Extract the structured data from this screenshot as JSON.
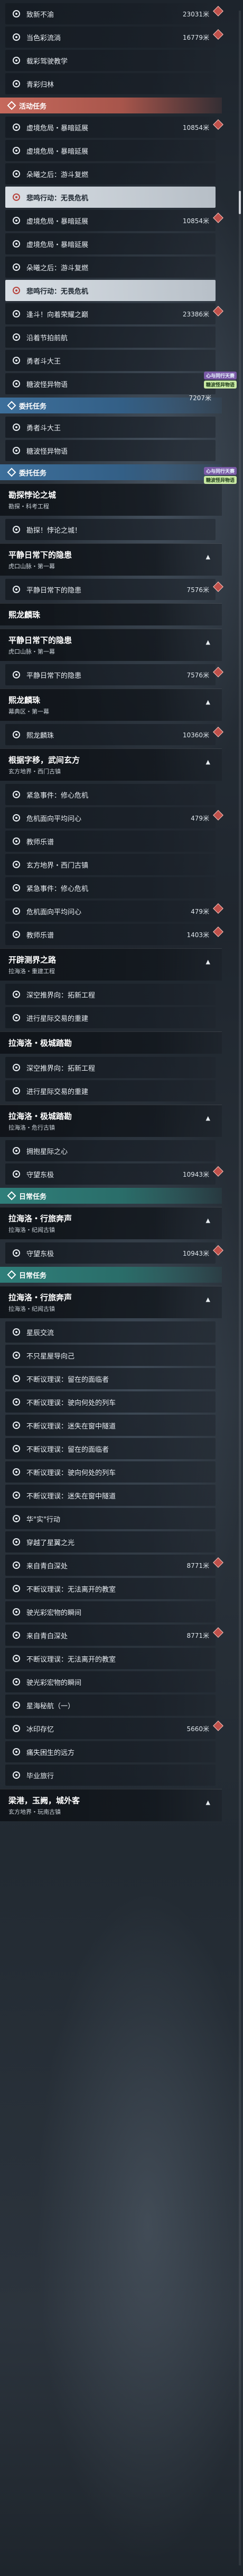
{
  "quest_list": {
    "items": [
      {
        "kind": "row",
        "name": "致新不渝",
        "dist": "23031米"
      },
      {
        "kind": "row",
        "name": "当色彩流淌",
        "dist": "16779米"
      },
      {
        "kind": "row",
        "name": "载彩驾驶教学",
        "dist": ""
      },
      {
        "kind": "row",
        "name": "青彩归林",
        "dist": ""
      },
      {
        "kind": "cat",
        "style": "event",
        "label": "活动任务"
      },
      {
        "kind": "row",
        "name": "虚境危局・暴暗延展",
        "dist": "10854米"
      },
      {
        "kind": "row",
        "name": "虚境危局・暴暗延展",
        "dist": ""
      },
      {
        "kind": "row",
        "name": "朵曦之后：游斗复燃",
        "dist": ""
      },
      {
        "kind": "row",
        "name": "悲鸣行动：无畏危机",
        "dist": "",
        "active": true
      },
      {
        "kind": "row",
        "name": "虚境危局・暴暗延展",
        "dist": "10854米"
      },
      {
        "kind": "row",
        "name": "虚境危局・暴暗延展",
        "dist": ""
      },
      {
        "kind": "row",
        "name": "朵曦之后：游斗复燃",
        "dist": ""
      },
      {
        "kind": "row",
        "name": "悲鸣行动：无畏危机",
        "dist": "",
        "active": true
      },
      {
        "kind": "row",
        "name": "逢斗！向着荣耀之巅",
        "dist": "23386米"
      },
      {
        "kind": "row",
        "name": "沿着节拍前航",
        "dist": ""
      },
      {
        "kind": "row",
        "name": "勇者斗大王",
        "dist": ""
      },
      {
        "kind": "row",
        "name": "糖波怪异物语",
        "dist": ""
      },
      {
        "kind": "cat",
        "style": "legend",
        "label": "委托任务"
      },
      {
        "kind": "row",
        "name": "勇者斗大王",
        "dist": ""
      },
      {
        "kind": "row",
        "name": "糖波怪异物语",
        "dist": ""
      },
      {
        "kind": "cat",
        "style": "legend",
        "label": "委托任务"
      },
      {
        "kind": "head",
        "title": "勘探悖论之城",
        "sub": "勘探・科考工程",
        "chev": ""
      },
      {
        "kind": "row",
        "name": "勘探！悖论之城！",
        "dist": ""
      },
      {
        "kind": "head",
        "title": "平静日常下的隐患",
        "sub": "虎口山脉・第一幕",
        "chev": "▲"
      },
      {
        "kind": "row",
        "name": "平静日常下的隐患",
        "dist": "7576米"
      },
      {
        "kind": "head",
        "title": "熙龙麟珠",
        "sub": "",
        "chev": ""
      },
      {
        "kind": "head",
        "title": "平静日常下的隐患",
        "sub": "虎口山脉・第一幕",
        "chev": "▲"
      },
      {
        "kind": "row",
        "name": "平静日常下的隐患",
        "dist": "7576米"
      },
      {
        "kind": "head",
        "title": "熙龙麟珠",
        "sub": "幕典区・第一幕",
        "chev": "▲"
      },
      {
        "kind": "row",
        "name": "熙龙麟珠",
        "dist": "10360米"
      },
      {
        "kind": "head",
        "title": "根据字移，武间玄方",
        "sub": "玄方地界・西门古镇",
        "chev": "▲"
      },
      {
        "kind": "row",
        "name": "紧急事件：修心危机",
        "dist": ""
      },
      {
        "kind": "row",
        "name": "危机面向平均问心",
        "dist": "479米"
      },
      {
        "kind": "row",
        "name": "教师乐谱",
        "dist": ""
      },
      {
        "kind": "row",
        "name": "玄方地界・西门古镇",
        "dist": ""
      },
      {
        "kind": "row",
        "name": "紧急事件：修心危机",
        "dist": ""
      },
      {
        "kind": "row",
        "name": "危机面向平均问心",
        "dist": "479米"
      },
      {
        "kind": "row",
        "name": "教师乐谱",
        "dist": "1403米"
      },
      {
        "kind": "head",
        "title": "开辟测界之路",
        "sub": "拉海洛・重建工程",
        "chev": "▲"
      },
      {
        "kind": "row",
        "name": "深空推界向：拓新工程",
        "dist": ""
      },
      {
        "kind": "row",
        "name": "进行星际交易的重建",
        "dist": ""
      },
      {
        "kind": "head",
        "title": "拉海洛・极城踏勘",
        "sub": "",
        "chev": ""
      },
      {
        "kind": "row",
        "name": "深空推界向：拓新工程",
        "dist": ""
      },
      {
        "kind": "row",
        "name": "进行星际交易的重建",
        "dist": ""
      },
      {
        "kind": "head",
        "title": "拉海洛・极城踏勘",
        "sub": "拉海洛・危行古镇",
        "chev": "▲"
      },
      {
        "kind": "row",
        "name": "拥抱星际之心",
        "dist": ""
      },
      {
        "kind": "row",
        "name": "守望东极",
        "dist": "10943米"
      },
      {
        "kind": "cat",
        "style": "daily",
        "label": "日常任务"
      },
      {
        "kind": "head",
        "title": "拉海洛・行旅奔声",
        "sub": "拉海洛・纪闻古镇",
        "chev": "▲"
      },
      {
        "kind": "row",
        "name": "守望东极",
        "dist": "10943米"
      },
      {
        "kind": "cat",
        "style": "daily",
        "label": "日常任务"
      },
      {
        "kind": "head",
        "title": "拉海洛・行旅奔声",
        "sub": "拉海洛・纪闻古镇",
        "chev": "▲"
      },
      {
        "kind": "row",
        "name": "星辰交流",
        "dist": ""
      },
      {
        "kind": "row",
        "name": "不只星屋导向己",
        "dist": ""
      },
      {
        "kind": "row",
        "name": "不断议理误：留在的面临者",
        "dist": ""
      },
      {
        "kind": "row",
        "name": "不断议理误：驶向何处的列车",
        "dist": ""
      },
      {
        "kind": "row",
        "name": "不断议理误：迷失在窗中隧道",
        "dist": ""
      },
      {
        "kind": "row",
        "name": "不断议理误：留在的面临者",
        "dist": ""
      },
      {
        "kind": "row",
        "name": "不断议理误：驶向何处的列车",
        "dist": ""
      },
      {
        "kind": "row",
        "name": "不断议理误：迷失在窗中隧道",
        "dist": ""
      },
      {
        "kind": "row",
        "name": "华\"实\"行动",
        "dist": ""
      },
      {
        "kind": "row",
        "name": "穿越了星翼之光",
        "dist": ""
      },
      {
        "kind": "row",
        "name": "来自青白深处",
        "dist": "8771米"
      },
      {
        "kind": "row",
        "name": "不断议理误：无法离开的教室",
        "dist": ""
      },
      {
        "kind": "row",
        "name": "驶光彩宏物的瞬间",
        "dist": ""
      },
      {
        "kind": "row",
        "name": "来自青白深处",
        "dist": "8771米"
      },
      {
        "kind": "row",
        "name": "不断议理误：无法离开的教室",
        "dist": ""
      },
      {
        "kind": "row",
        "name": "驶光彩宏物的瞬间",
        "dist": ""
      },
      {
        "kind": "row",
        "name": "星海秘航（一）",
        "dist": ""
      },
      {
        "kind": "row",
        "name": "冰印存忆",
        "dist": "5660米"
      },
      {
        "kind": "row",
        "name": "痛失困生的远方",
        "dist": ""
      },
      {
        "kind": "row",
        "name": "毕业旅行",
        "dist": ""
      },
      {
        "kind": "head",
        "title": "梁港，玉阙，城外客",
        "sub": "玄方地界・玩南古镇",
        "chev": "▲"
      }
    ]
  },
  "promo": {
    "line1": "心与同行天赛",
    "line1_top": "7207米",
    "line2": "糖波怪异物语"
  },
  "colors": {
    "event_tab": "#c6695c",
    "legend_tab": "#3d6f9b",
    "daily_tab": "#2f7f7a",
    "active_marker": "#b7423b"
  },
  "icons": {
    "row": "quest-circle-icon",
    "category": "diamond-tag-icon",
    "expand": "chevron-up-icon",
    "alert": "red-diamond-badge-icon"
  }
}
